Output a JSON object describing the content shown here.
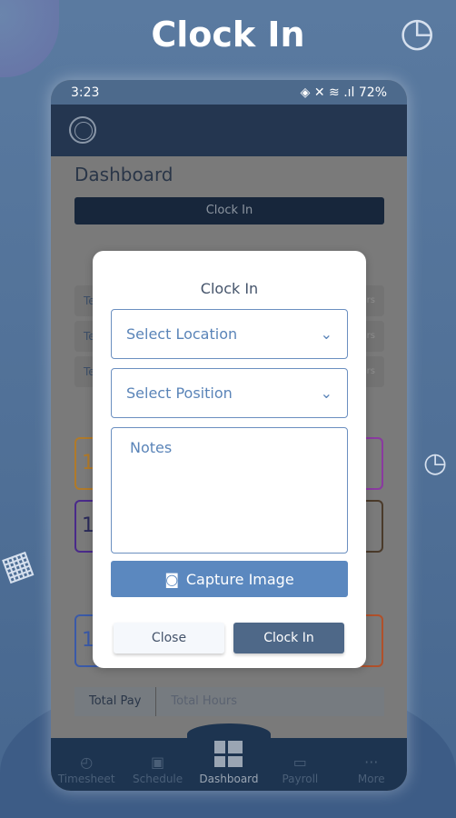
{
  "hero": {
    "title": "Clock In"
  },
  "status_bar": {
    "time": "3:23",
    "battery": "72%"
  },
  "dashboard": {
    "title": "Dashboard",
    "clock_in_label": "Clock In",
    "rows": [
      {
        "left": "Te",
        "right": "urs"
      },
      {
        "left": "Te",
        "right": "urs"
      },
      {
        "left": "Te",
        "right": "urs"
      }
    ],
    "cards": [
      "1",
      "14",
      "1"
    ],
    "tabs": [
      "Total Pay",
      "Total Hours"
    ]
  },
  "modal": {
    "title": "Clock In",
    "location_placeholder": "Select Location",
    "position_placeholder": "Select Position",
    "notes_placeholder": "Notes",
    "capture_label": "Capture Image",
    "close_label": "Close",
    "clock_in_label": "Clock In"
  },
  "nav": [
    {
      "label": "Timesheet",
      "icon": "timesheet-icon"
    },
    {
      "label": "Schedule",
      "icon": "calendar-icon"
    },
    {
      "label": "Dashboard",
      "icon": "dashboard-icon",
      "active": true
    },
    {
      "label": "Payroll",
      "icon": "payroll-icon"
    },
    {
      "label": "More",
      "icon": "more-icon"
    }
  ]
}
